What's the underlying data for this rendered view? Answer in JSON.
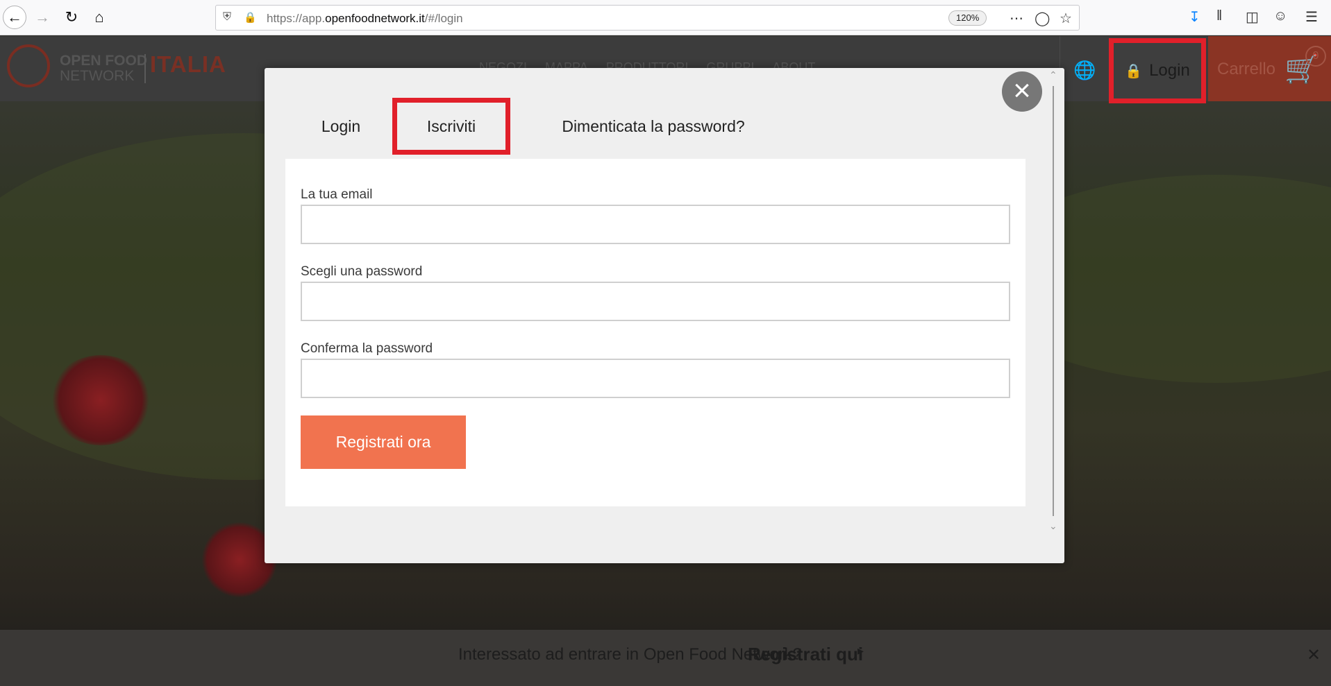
{
  "browser": {
    "url_prefix": "https://app.",
    "url_domain": "openfoodnetwork.it",
    "url_suffix": "/#/login",
    "zoom": "120%"
  },
  "site": {
    "logo_line1": "OPEN FOOD",
    "logo_line2": "NETWORK",
    "logo_country": "ITALIA",
    "nav": [
      "NEGOZI",
      "MAPPA",
      "PRODUTTORI",
      "GRUPPI",
      "ABOUT"
    ],
    "login_label": "Login",
    "cart_label": "Carrello",
    "cart_count": "0",
    "banner_text": "Interessato ad entrare in Open Food Network?",
    "banner_link": "Registrati qui"
  },
  "modal": {
    "tabs": {
      "login": "Login",
      "signup": "Iscriviti",
      "forgot": "Dimenticata la password?"
    },
    "fields": {
      "email_label": "La tua email",
      "password_label": "Scegli una password",
      "confirm_label": "Conferma la password",
      "email_value": "",
      "password_value": "",
      "confirm_value": ""
    },
    "submit_label": "Registrati ora"
  },
  "colors": {
    "accent_orange": "#f1734f",
    "highlight_red": "#e1202a"
  }
}
